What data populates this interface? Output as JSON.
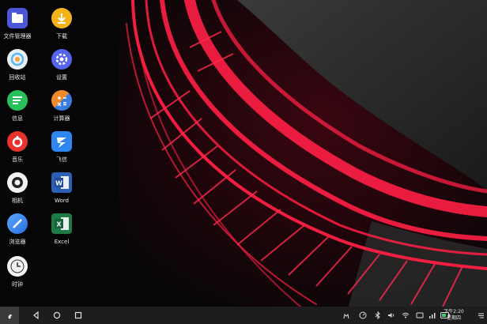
{
  "apps": [
    {
      "label": "文件管理器",
      "icon": "folder-icon",
      "color": "#4b57d6"
    },
    {
      "label": "下载",
      "icon": "download-icon",
      "color": "#f2b418"
    },
    {
      "label": "回收站",
      "icon": "recycle-bin-icon",
      "color": "#e9eef3"
    },
    {
      "label": "设置",
      "icon": "settings-icon",
      "color": "#5564e8"
    },
    {
      "label": "信息",
      "icon": "message-icon",
      "color": "#28c05a"
    },
    {
      "label": "计算器",
      "icon": "calculator-icon",
      "color": "#f08a2a"
    },
    {
      "label": "音乐",
      "icon": "music-icon",
      "color": "#e8322e"
    },
    {
      "label": "飞信",
      "icon": "fetion-icon",
      "color": "#2f86f0"
    },
    {
      "label": "相机",
      "icon": "camera-icon",
      "color": "#f2f2f2"
    },
    {
      "label": "Word",
      "icon": "word-icon",
      "color": "#2b5fb8"
    },
    {
      "label": "浏览器",
      "icon": "browser-icon",
      "color": "#3b8ff0"
    },
    {
      "label": "Excel",
      "icon": "excel-icon",
      "color": "#1f7a45"
    },
    {
      "label": "时钟",
      "icon": "clock-icon",
      "color": "#f4f4f4"
    }
  ],
  "taskbar": {
    "start_icon": "start-logo-icon",
    "nav": [
      "back-icon",
      "home-icon",
      "recents-icon"
    ],
    "tray": [
      "person-icon",
      "speedometer-icon",
      "bluetooth-icon",
      "volume-icon",
      "wifi-icon",
      "tablet-icon",
      "signal-icon",
      "battery-icon"
    ],
    "time": "下午2:20",
    "weekday": "星期四",
    "notification_icon": "notification-list-icon"
  },
  "colors": {
    "taskbar_bg": "#1d1d1f",
    "accent_red": "#ff2a4e"
  }
}
